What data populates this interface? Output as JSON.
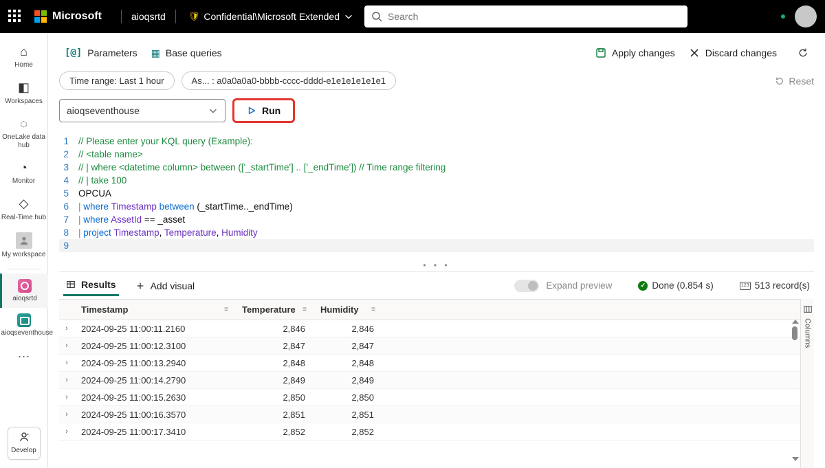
{
  "header": {
    "brand": "Microsoft",
    "workspace": "aioqsrtd",
    "sensitivity": "Confidential\\Microsoft Extended",
    "search_placeholder": "Search"
  },
  "rail": {
    "home": "Home",
    "workspaces": "Workspaces",
    "onelake": "OneLake data hub",
    "monitor": "Monitor",
    "realtime": "Real-Time hub",
    "myws": "My workspace",
    "item1": "aioqsrtd",
    "item2": "aioqseventhouse",
    "develop": "Develop"
  },
  "toolbar": {
    "parameters": "Parameters",
    "base_queries": "Base queries",
    "apply": "Apply changes",
    "discard": "Discard changes"
  },
  "chips": {
    "timerange": "Time range: Last 1 hour",
    "asset": "As... : a0a0a0a0-bbbb-cccc-dddd-e1e1e1e1e1e1",
    "reset": "Reset"
  },
  "query": {
    "database": "aioqseventhouse",
    "run": "Run",
    "lines": [
      "// Please enter your KQL query (Example):",
      "// <table name>",
      "// | where <datetime column> between (['_startTime'] .. ['_endTime']) // Time range filtering",
      "// | take 100",
      "OPCUA",
      "| where Timestamp between (_startTime.._endTime)",
      "| where AssetId == _asset",
      "| project Timestamp, Temperature, Humidity",
      ""
    ]
  },
  "results": {
    "tab_results": "Results",
    "add_visual": "Add visual",
    "expand": "Expand preview",
    "done": "Done (0.854 s)",
    "records": "513 record(s)",
    "columns_label": "Columns",
    "headers": {
      "c1": "Timestamp",
      "c2": "Temperature",
      "c3": "Humidity"
    },
    "rows": [
      {
        "ts": "2024-09-25 11:00:11.2160",
        "temp": "2,846",
        "hum": "2,846"
      },
      {
        "ts": "2024-09-25 11:00:12.3100",
        "temp": "2,847",
        "hum": "2,847"
      },
      {
        "ts": "2024-09-25 11:00:13.2940",
        "temp": "2,848",
        "hum": "2,848"
      },
      {
        "ts": "2024-09-25 11:00:14.2790",
        "temp": "2,849",
        "hum": "2,849"
      },
      {
        "ts": "2024-09-25 11:00:15.2630",
        "temp": "2,850",
        "hum": "2,850"
      },
      {
        "ts": "2024-09-25 11:00:16.3570",
        "temp": "2,851",
        "hum": "2,851"
      },
      {
        "ts": "2024-09-25 11:00:17.3410",
        "temp": "2,852",
        "hum": "2,852"
      }
    ]
  }
}
